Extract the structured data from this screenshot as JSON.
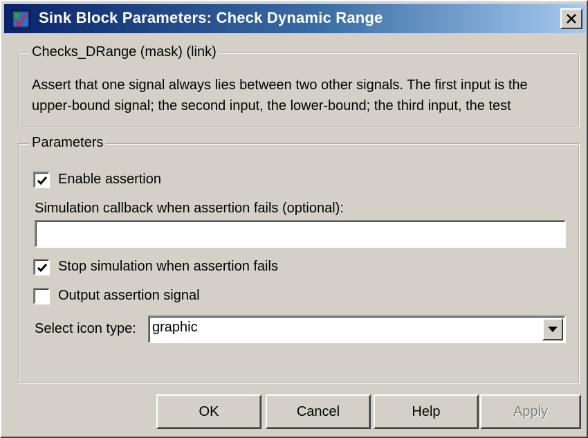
{
  "window": {
    "title": "Sink Block Parameters: Check  Dynamic Range"
  },
  "mask_group": {
    "legend": "Checks_DRange (mask) (link)",
    "description_line1": "Assert that one signal always lies between two other signals.  The first input is the",
    "description_line2": "upper-bound signal; the second input, the lower-bound; the third input, the test"
  },
  "params_group": {
    "legend": "Parameters",
    "enable_assertion": {
      "label": "Enable assertion",
      "checked": true
    },
    "callback": {
      "label": "Simulation callback when assertion fails (optional):",
      "value": ""
    },
    "stop_simulation": {
      "label": "Stop simulation when assertion fails",
      "checked": true
    },
    "output_signal": {
      "label": "Output assertion signal",
      "checked": false
    },
    "icon_type": {
      "label": "Select icon type:",
      "value": "graphic"
    }
  },
  "buttons": {
    "ok": "OK",
    "cancel": "Cancel",
    "help": "Help",
    "apply": "Apply"
  },
  "icons": {
    "app": "simulink-block-icon",
    "close": "close-icon",
    "check": "check-mark-icon",
    "dropdown": "chevron-down-icon"
  }
}
